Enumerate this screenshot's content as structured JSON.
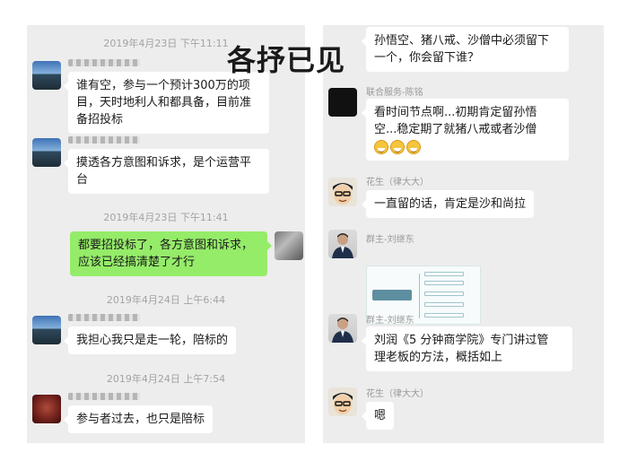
{
  "overlay_title": "各抒已见",
  "left_chat": {
    "timestamps": [
      "2019年4月23日 下午11:11",
      "2019年4月23日 下午11:41",
      "2019年4月24日 上午6:44",
      "2019年4月24日 上午7:54"
    ],
    "messages": [
      {
        "lines": [
          "谁有空，参与一个预计300万的项",
          "目，天时地利人和都具备，目前准",
          "备招投标"
        ]
      },
      {
        "lines": [
          "摸透各方意图和诉求，是个运营平",
          "台"
        ]
      },
      {
        "lines": [
          "都要招投标了，各方意图和诉求，",
          "应该已经搞清楚了才行"
        ]
      },
      {
        "lines": [
          "我担心我只是走一轮，陪标的"
        ]
      },
      {
        "lines": [
          "参与者过去，也只是陪标"
        ]
      }
    ]
  },
  "right_chat": {
    "messages": [
      {
        "sender": "",
        "lines": [
          "孙悟空、猪八戒、沙僧中必须留下",
          "一个，你会留下谁？"
        ]
      },
      {
        "sender": "联合服务-陈铭",
        "lines": [
          "看时间节点啊...初期肯定留孙悟",
          "空...稳定期了就猪八戒或者沙僧"
        ]
      },
      {
        "sender": "花生（律大大）",
        "lines": [
          "一直留的话，肯定是沙和尚拉"
        ]
      },
      {
        "sender": "群主-刘继东",
        "lines": []
      },
      {
        "sender": "群主-刘继东",
        "lines": [
          "刘润《5 分钟商学院》专门讲过管",
          "理老板的方法，概括如上"
        ]
      },
      {
        "sender": "花生（律大大）",
        "lines": [
          "嗯"
        ]
      }
    ]
  },
  "colors": {
    "chat_bg": "#ededed",
    "my_bubble": "#95ec69",
    "their_bubble": "#ffffff",
    "timestamp": "#a3a3a3"
  },
  "icons": [
    "landscape-avatar-icon",
    "dark-avatar-icon",
    "cartoon-face-avatar-icon",
    "man-portrait-avatar-icon",
    "red-avatar-icon",
    "grin-emoji-icon"
  ]
}
